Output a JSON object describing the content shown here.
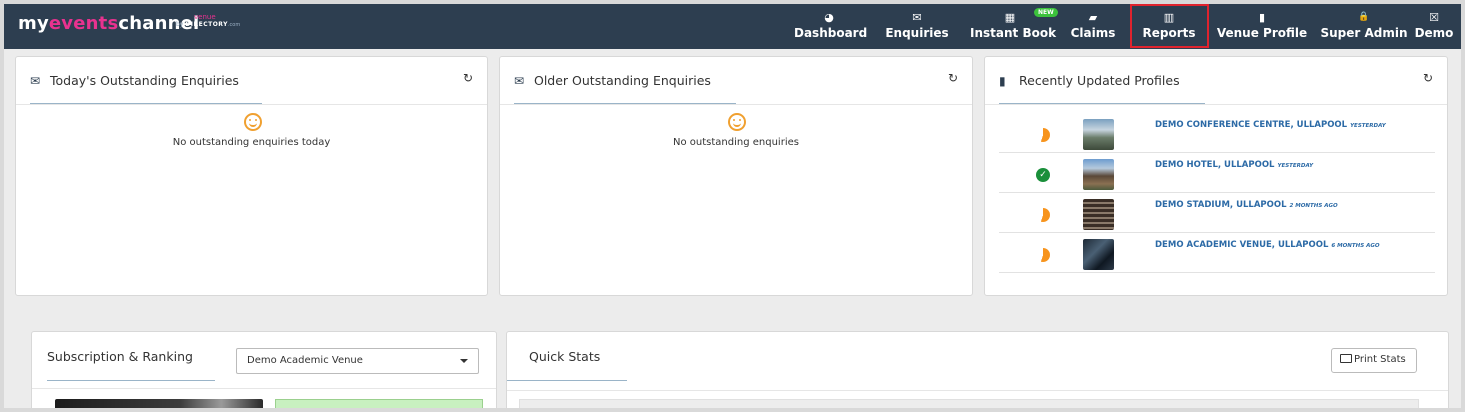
{
  "brand": {
    "my": "my",
    "events": "events",
    "channel": "channel",
    "by": "by",
    "venue": "venue",
    "directory": "DIRECTORY",
    "com": ".com"
  },
  "nav": [
    {
      "label": "Dashboard",
      "icon": "dashboard-icon",
      "glyph": "◕"
    },
    {
      "label": "Enquiries",
      "icon": "envelope-icon",
      "glyph": "✉"
    },
    {
      "label": "Instant Book",
      "icon": "calendar-icon",
      "glyph": "▦",
      "badge": "NEW"
    },
    {
      "label": "Claims",
      "icon": "book-icon",
      "glyph": "▰"
    },
    {
      "label": "Reports",
      "icon": "bar-chart-icon",
      "glyph": "▥"
    },
    {
      "label": "Venue Profile",
      "icon": "building-icon",
      "glyph": "▮"
    },
    {
      "label": "Super Admin",
      "icon": "lock-icon",
      "glyph": "🔒"
    },
    {
      "label": "Demo",
      "icon": "user-icon",
      "glyph": "☒"
    }
  ],
  "panels": {
    "today": {
      "title": "Today's Outstanding Enquiries",
      "empty": "No outstanding enquiries today"
    },
    "older": {
      "title": "Older Outstanding Enquiries",
      "empty": "No outstanding enquiries"
    },
    "profiles": {
      "title": "Recently Updated Profiles",
      "items": [
        {
          "name": "DEMO CONFERENCE CENTRE, ULLAPOOL",
          "ago": "YESTERDAY",
          "status": "partial"
        },
        {
          "name": "DEMO HOTEL, ULLAPOOL",
          "ago": "YESTERDAY",
          "status": "complete"
        },
        {
          "name": "DEMO STADIUM, ULLAPOOL",
          "ago": "2 MONTHS AGO",
          "status": "partial"
        },
        {
          "name": "DEMO ACADEMIC VENUE, ULLAPOOL",
          "ago": "6 MONTHS AGO",
          "status": "partial"
        }
      ]
    },
    "subscription": {
      "title": "Subscription & Ranking",
      "select_value": "Demo Academic Venue"
    },
    "quickstats": {
      "title": "Quick Stats",
      "print_label": "Print Stats"
    }
  },
  "colors": {
    "navbar": "#2d3e50",
    "accent": "#e8328f",
    "link": "#2c6aa6",
    "highlight": "#e0232e",
    "badge": "#3cc23c"
  }
}
